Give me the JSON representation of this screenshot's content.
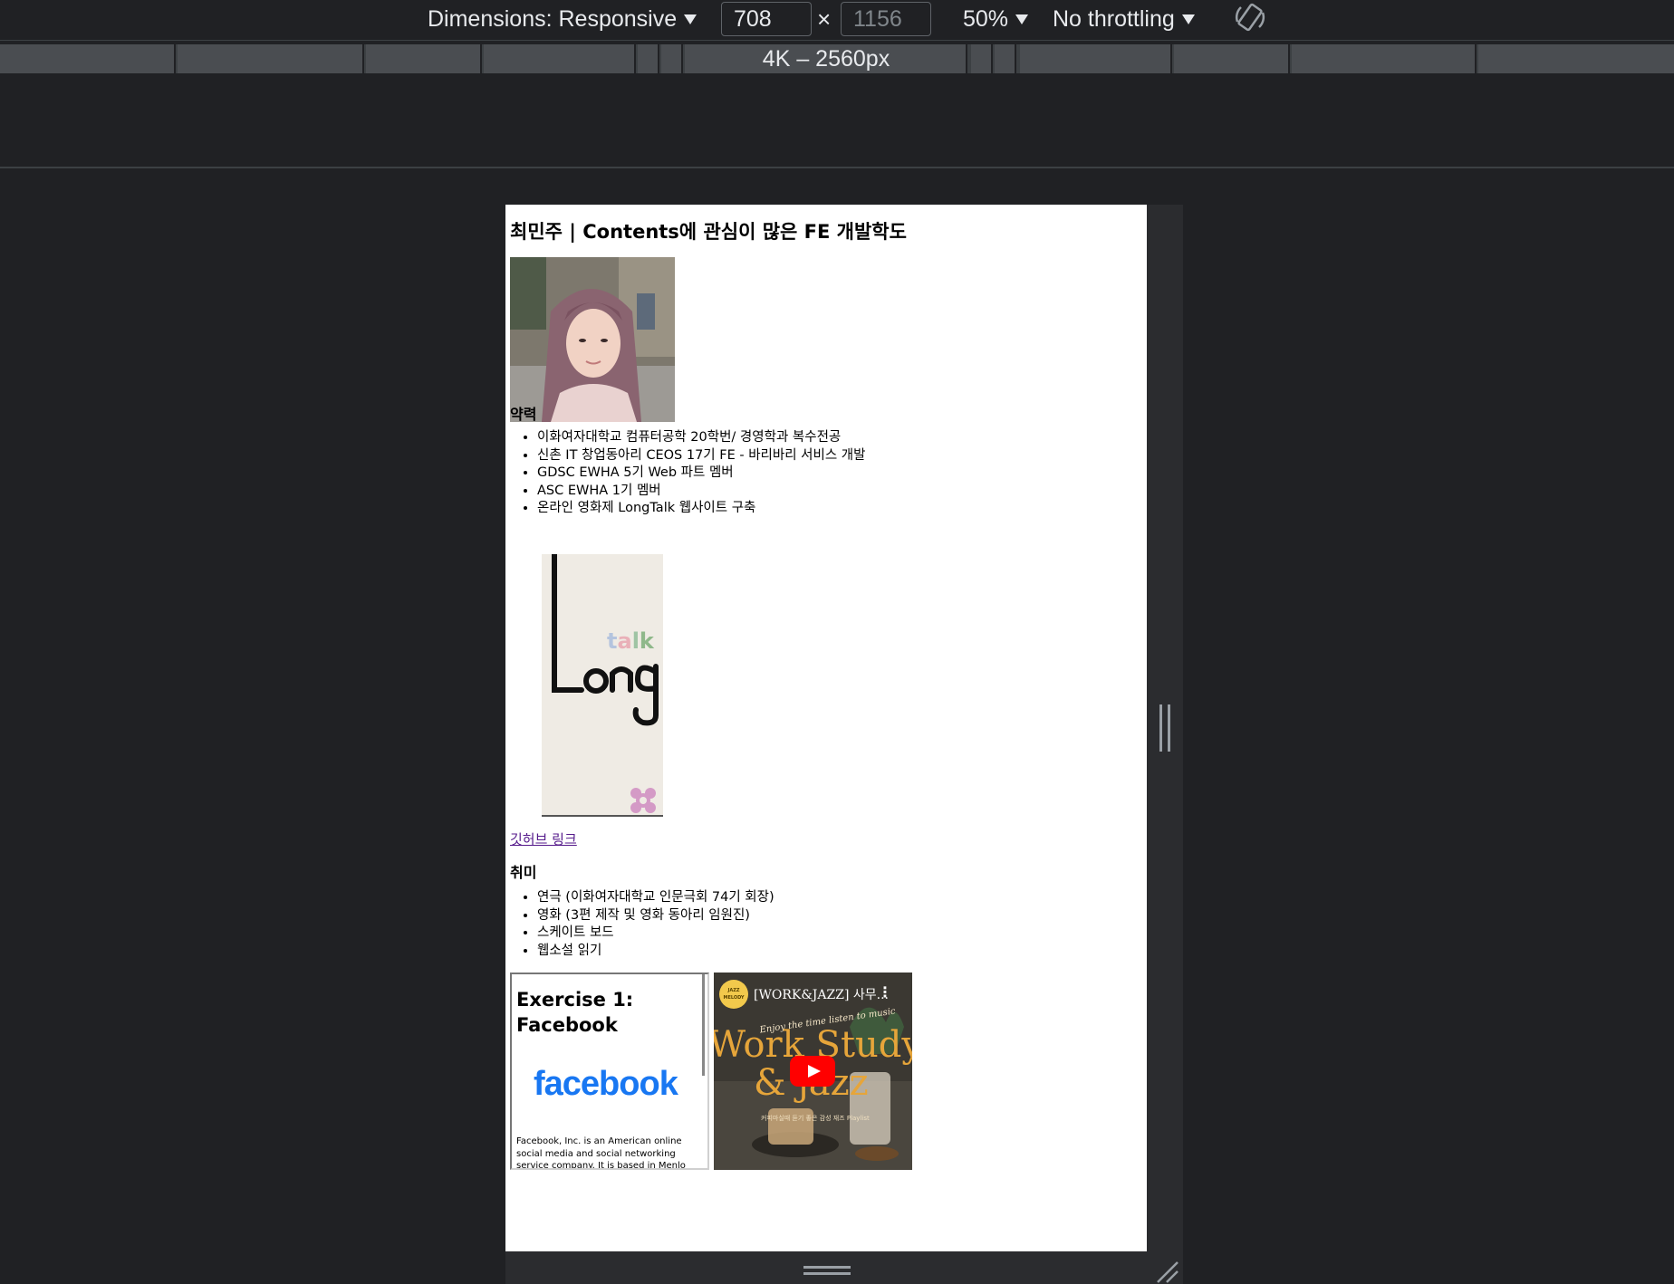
{
  "toolbar": {
    "dimensions_label": "Dimensions: Responsive",
    "width_value": "708",
    "height_placeholder": "1156",
    "times": "×",
    "zoom": "50%",
    "throttling": "No throttling"
  },
  "media_query_bar": {
    "label": "4K – 2560px"
  },
  "page": {
    "title": "최민주 | Contents에 관심이 많은 FE 개발학도",
    "career_heading": "약력",
    "career_items": [
      "이화여자대학교 컴퓨터공학 20학번/ 경영학과 복수전공",
      "신촌 IT 창업동아리 CEOS 17기 FE - 바리바리 서비스 개발",
      "GDSC EWHA 5기 Web 파트 멤버",
      "ASC EWHA 1기 멤버",
      "온라인 영화제 LongTalk 웹사이트 구축"
    ],
    "longtalk_logo": {
      "top": "talk",
      "main": "Long"
    },
    "github_link": "깃허브 링크",
    "hobby_heading": "취미",
    "hobby_items": [
      "연극 (이화여자대학교 인문극회 74기 회장)",
      "영화 (3편 제작 및 영화 동아리 임원진)",
      "스케이트 보드",
      "웹소설 읽기"
    ],
    "iframe_facebook": {
      "title": "Exercise 1: Facebook",
      "logo": "facebook",
      "description": "Facebook, Inc. is an American online social media and social networking service company. It is based in Menlo Park,"
    },
    "youtube_embed": {
      "channel_badge": "JAZZ MELODY",
      "title": "[WORK&JAZZ] 사무...",
      "menu": "⋮",
      "subtitle": "Enjoy the time listen to music",
      "big_text_1": "Work Study",
      "big_text_2": "& jazz",
      "korean_caption": "커피마실때 듣기 좋은 감성 재즈 Playlist"
    }
  },
  "colors": {
    "devtools_bg": "#202124",
    "link_visited": "#551a8b",
    "facebook_blue": "#1877f2",
    "youtube_red": "#ff0000"
  }
}
